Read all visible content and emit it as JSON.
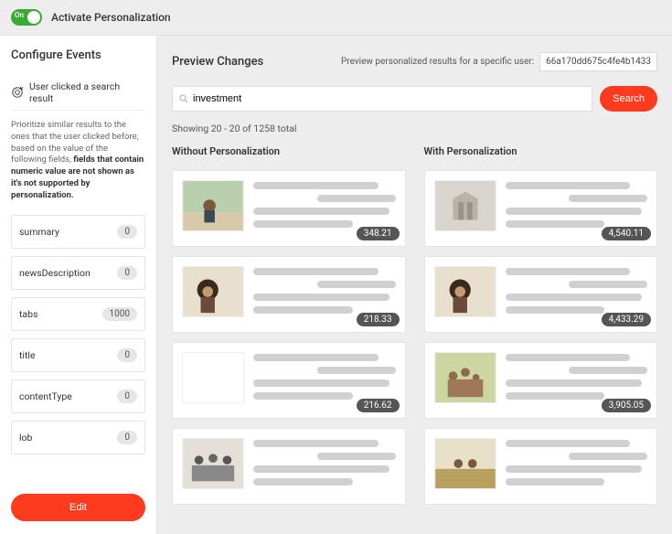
{
  "topbar": {
    "toggle_label": "On",
    "title": "Activate Personalization"
  },
  "sidebar": {
    "title": "Configure Events",
    "event_label": "User clicked a search result",
    "desc_plain": "Prioritize similar results to the ones that the user clicked before, based on the value of the following fields, ",
    "desc_bold": "fields that contain numeric value are not shown as it's not supported by personalization.",
    "fields": [
      {
        "name": "summary",
        "value": "0"
      },
      {
        "name": "newsDescription",
        "value": "0"
      },
      {
        "name": "tabs",
        "value": "1000"
      },
      {
        "name": "title",
        "value": "0"
      },
      {
        "name": "contentType",
        "value": "0"
      },
      {
        "name": "lob",
        "value": "0"
      }
    ],
    "edit_label": "Edit"
  },
  "content": {
    "title": "Preview Changes",
    "user_label": "Preview personalized results for a specific user:",
    "user_id": "66a170dd675c4fe4b1433",
    "search_value": "investment",
    "search_btn": "Search",
    "showing": "Showing 20 - 20 of 1258 total",
    "col_without": "Without Personalization",
    "col_with": "With Personalization",
    "without_cards": [
      {
        "score": "348.21",
        "thumb": "woman-shore"
      },
      {
        "score": "218.33",
        "thumb": "curly-woman"
      },
      {
        "score": "216.62",
        "thumb": "blank"
      },
      {
        "score": "",
        "thumb": "boardroom"
      }
    ],
    "with_cards": [
      {
        "score": "4,540.11",
        "thumb": "building"
      },
      {
        "score": "4,433.29",
        "thumb": "curly-woman"
      },
      {
        "score": "3,905.05",
        "thumb": "family"
      },
      {
        "score": "",
        "thumb": "kids-field"
      }
    ]
  }
}
